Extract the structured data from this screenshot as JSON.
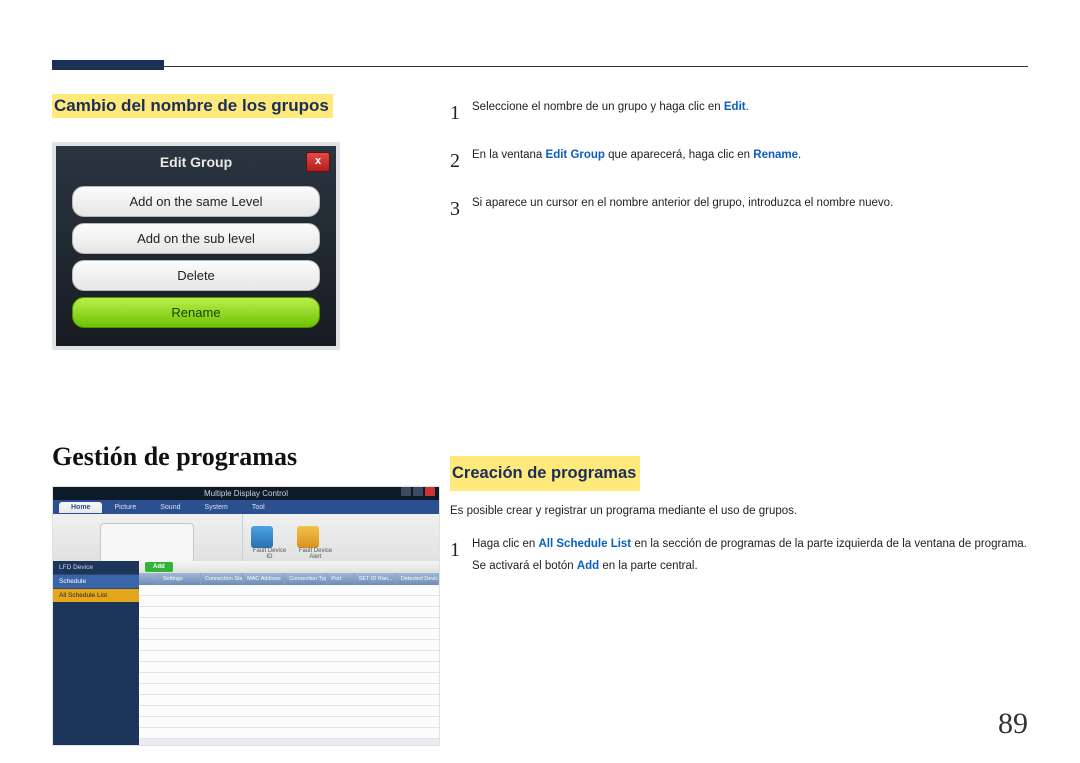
{
  "page_number": "89",
  "section1": {
    "heading": "Cambio del nombre de los grupos",
    "dialog": {
      "title": "Edit Group",
      "close": "x",
      "options": [
        "Add on the same Level",
        "Add on the sub level",
        "Delete",
        "Rename"
      ]
    }
  },
  "steps1": [
    {
      "n": "1",
      "pre": "Seleccione el nombre de un grupo y haga clic en ",
      "b1": "Edit",
      "post": "."
    },
    {
      "n": "2",
      "pre": "En la ventana ",
      "b1": "Edit Group",
      "mid": " que aparecerá, haga clic en ",
      "b2": "Rename",
      "post": "."
    },
    {
      "n": "3",
      "pre": "Si aparece un cursor en el nombre anterior del grupo, introduzca el nombre nuevo.",
      "b1": "",
      "post": ""
    }
  ],
  "section2": {
    "big_heading": "Gestión de programas",
    "heading": "Creación de programas",
    "intro": "Es posible crear y registrar un programa mediante el uso de grupos.",
    "step": {
      "n": "1",
      "pre": "Haga clic en ",
      "b1": "All Schedule List",
      "mid": " en la sección de programas de la parte izquierda de la ventana de programa. Se activará el botón ",
      "b2": "Add",
      "post": " en la parte central."
    }
  },
  "mdc": {
    "title": "Multiple Display Control",
    "tabs": [
      "Home",
      "Picture",
      "Sound",
      "System",
      "Tool"
    ],
    "ribbon_right": [
      {
        "label": "Fault Device\nID"
      },
      {
        "label": "Fault Device\nAlert"
      }
    ],
    "side": [
      {
        "label": "LFD Device",
        "type": "row"
      },
      {
        "label": "Schedule",
        "type": "on"
      },
      {
        "label": "All Schedule List",
        "type": "sub"
      }
    ],
    "add": "Add",
    "cols": [
      "",
      "Settings",
      "Connection Status",
      "MAC Address",
      "Connection Type",
      "Port",
      "SET ID Ran...",
      "Detected Devices"
    ]
  }
}
